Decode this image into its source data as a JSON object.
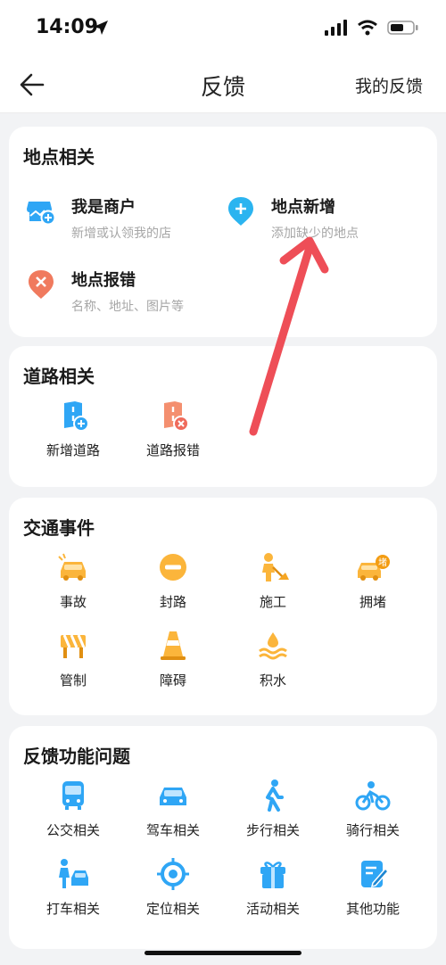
{
  "status": {
    "time": "14:09"
  },
  "nav": {
    "title": "反馈",
    "my_feedback": "我的反馈"
  },
  "place_section": {
    "title": "地点相关",
    "items": [
      {
        "title": "我是商户",
        "subtitle": "新增或认领我的店",
        "icon": "shop-plus-icon",
        "color": "#2fa6f5"
      },
      {
        "title": "地点新增",
        "subtitle": "添加缺少的地点",
        "icon": "location-plus-icon",
        "color": "#2bb4f0"
      },
      {
        "title": "地点报错",
        "subtitle": "名称、地址、图片等",
        "icon": "location-error-icon",
        "color": "#f07a5e"
      }
    ]
  },
  "road_section": {
    "title": "道路相关",
    "items": [
      {
        "label": "新增道路",
        "icon": "road-plus-icon"
      },
      {
        "label": "道路报错",
        "icon": "road-error-icon"
      }
    ]
  },
  "traffic_section": {
    "title": "交通事件",
    "items": [
      {
        "label": "事故",
        "icon": "accident-car-icon"
      },
      {
        "label": "封路",
        "icon": "road-closed-icon"
      },
      {
        "label": "施工",
        "icon": "construction-icon"
      },
      {
        "label": "拥堵",
        "icon": "congestion-icon"
      },
      {
        "label": "管制",
        "icon": "control-barrier-icon"
      },
      {
        "label": "障碍",
        "icon": "traffic-cone-icon"
      },
      {
        "label": "积水",
        "icon": "waterlogging-icon"
      }
    ],
    "badge": "堵"
  },
  "function_section": {
    "title": "反馈功能问题",
    "items": [
      {
        "label": "公交相关",
        "icon": "bus-icon"
      },
      {
        "label": "驾车相关",
        "icon": "car-icon"
      },
      {
        "label": "步行相关",
        "icon": "walk-icon"
      },
      {
        "label": "骑行相关",
        "icon": "bike-icon"
      },
      {
        "label": "打车相关",
        "icon": "taxi-icon"
      },
      {
        "label": "定位相关",
        "icon": "locate-icon"
      },
      {
        "label": "活动相关",
        "icon": "gift-icon"
      },
      {
        "label": "其他功能",
        "icon": "edit-icon"
      }
    ]
  },
  "colors": {
    "accent_blue": "#2fa6f5",
    "accent_orange": "#fbb53b",
    "annotation_red": "#ee4e57"
  }
}
